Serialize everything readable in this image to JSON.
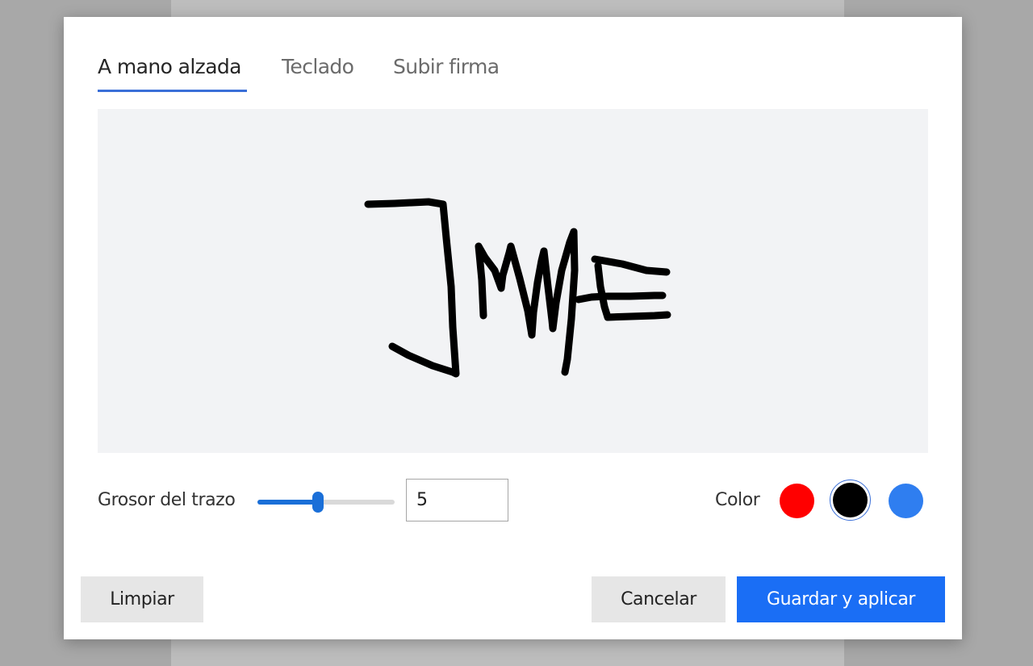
{
  "tabs": [
    {
      "label": "A mano alzada",
      "active": true
    },
    {
      "label": "Teclado",
      "active": false
    },
    {
      "label": "Subir firma",
      "active": false
    }
  ],
  "stroke": {
    "label": "Grosor del trazo",
    "value": "5",
    "slider_fraction": 0.44
  },
  "color": {
    "label": "Color",
    "options": [
      {
        "name": "red",
        "hex": "#ff0000"
      },
      {
        "name": "black",
        "hex": "#000000",
        "selected": true
      },
      {
        "name": "blue",
        "hex": "#2f7ef0"
      }
    ]
  },
  "buttons": {
    "clear": "Limpiar",
    "cancel": "Cancelar",
    "save": "Guardar y aplicar"
  },
  "colors": {
    "accent": "#1a6ef5",
    "canvas_bg": "#f2f3f5"
  }
}
